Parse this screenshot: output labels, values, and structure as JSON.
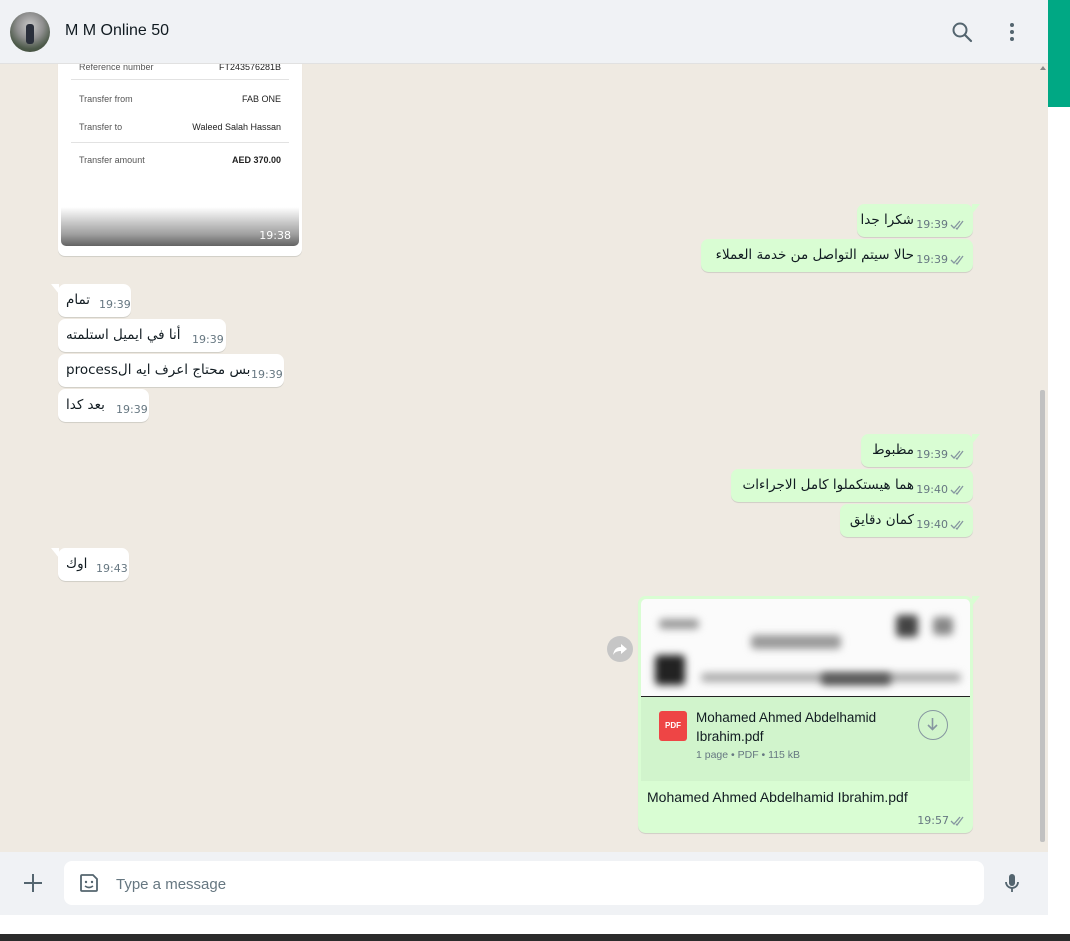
{
  "header": {
    "contact_name": "M M Online 50"
  },
  "receipt": {
    "rows": [
      {
        "label": "Reference number",
        "value": "FT243576281B"
      },
      {
        "label": "Transfer from",
        "value": "FAB ONE"
      },
      {
        "label": "Transfer to",
        "value": "Waleed Salah Hassan"
      },
      {
        "label": "Transfer amount",
        "value": "AED 370.00"
      }
    ],
    "time": "19:38"
  },
  "messages": [
    {
      "text": "شكرا جدا",
      "time": "19:39"
    },
    {
      "text": "حالا سيتم التواصل من خدمة العملاء",
      "time": "19:39"
    },
    {
      "text": "تمام",
      "time": "19:39"
    },
    {
      "text": "أنا في ايميل استلمته",
      "time": "19:39"
    },
    {
      "text": "بس محتاج اعرف ايه الprocess",
      "time": "19:39"
    },
    {
      "text": "بعد كدا",
      "time": "19:39"
    },
    {
      "text": "مظبوط",
      "time": "19:39"
    },
    {
      "text": "هما هيستكملوا كامل الاجراءات",
      "time": "19:40"
    },
    {
      "text": "كمان دقايق",
      "time": "19:40"
    },
    {
      "text": "اوك",
      "time": "19:43"
    }
  ],
  "document": {
    "name": "Mohamed Ahmed Abdelhamid Ibrahim.pdf",
    "icon_label": "PDF",
    "meta": "1 page • PDF • 115 kB",
    "caption": "Mohamed Ahmed Abdelhamid Ibrahim.pdf",
    "time": "19:57"
  },
  "composer": {
    "placeholder": "Type a message"
  },
  "colors": {
    "outgoing": "#d9fdd3",
    "incoming": "#ffffff",
    "accent": "#00a884",
    "background": "#efeae2"
  },
  "icons": {
    "search": "search-icon",
    "menu": "menu-icon",
    "attach": "plus-icon",
    "emoji": "sticker-icon",
    "mic": "mic-icon",
    "tick": "double-check-icon",
    "download": "download-icon",
    "forward": "forward-icon"
  }
}
